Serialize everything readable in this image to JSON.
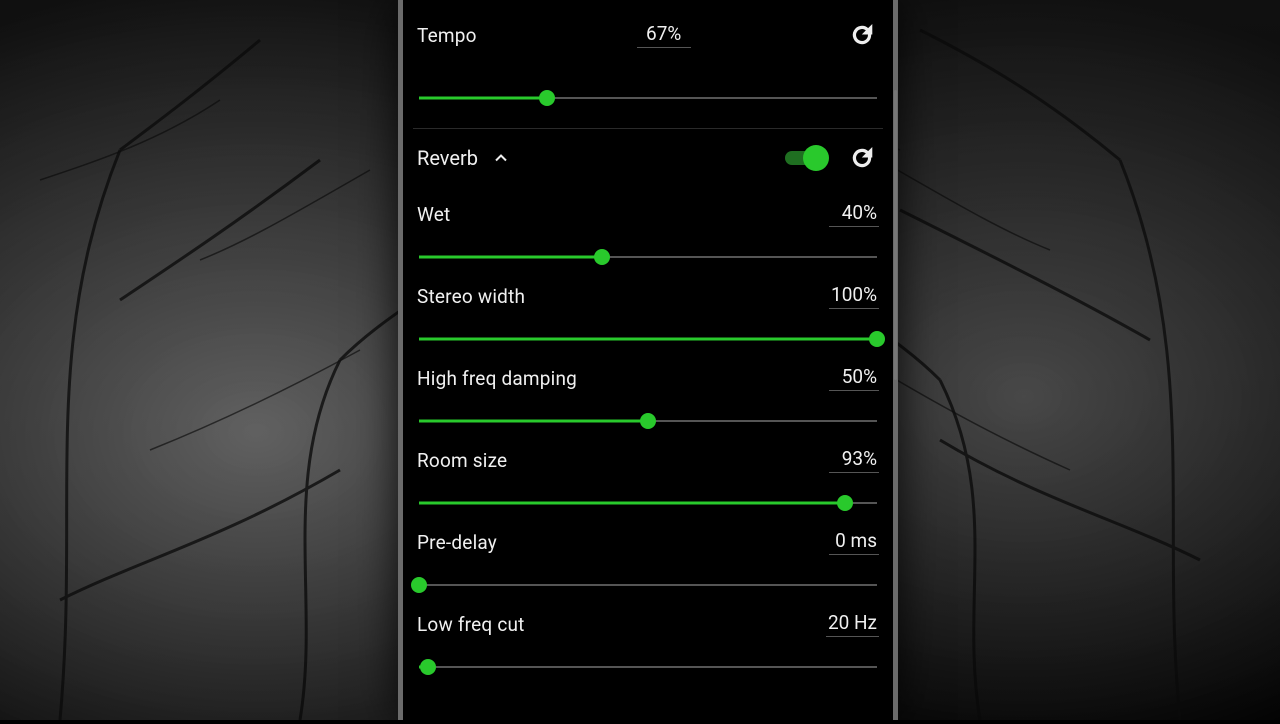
{
  "colors": {
    "accent": "#29c92c",
    "text": "#f0f0f0",
    "track": "#555555"
  },
  "tempo": {
    "label": "Tempo",
    "value_text": "67%",
    "slider_pct": 28
  },
  "reverb": {
    "title": "Reverb",
    "expanded": true,
    "enabled": true,
    "params": {
      "wet": {
        "label": "Wet",
        "value_text": "40%",
        "slider_pct": 40
      },
      "stereo_width": {
        "label": "Stereo width",
        "value_text": "100%",
        "slider_pct": 100
      },
      "hf_damping": {
        "label": "High freq damping",
        "value_text": "50%",
        "slider_pct": 50
      },
      "room_size": {
        "label": "Room size",
        "value_text": "93%",
        "slider_pct": 93
      },
      "pre_delay": {
        "label": "Pre-delay",
        "value_text": "0 ms",
        "slider_pct": 0
      },
      "low_freq_cut": {
        "label": "Low freq cut",
        "value_text": "20 Hz",
        "slider_pct": 2
      }
    }
  }
}
